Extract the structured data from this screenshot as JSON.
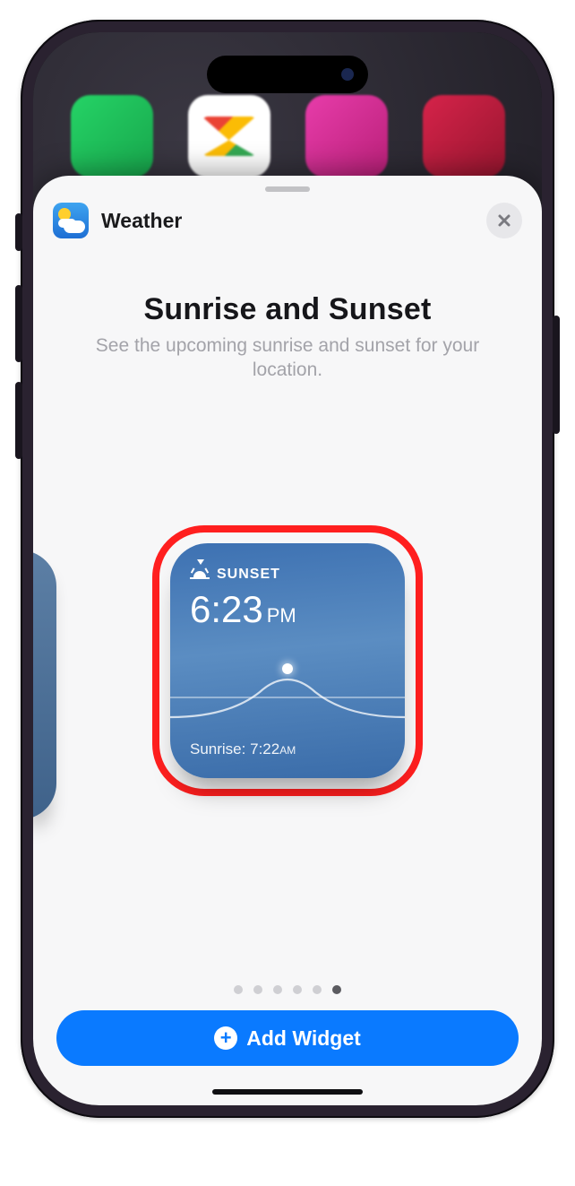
{
  "app_name": "Weather",
  "widget": {
    "title": "Sunrise and Sunset",
    "description": "See the upcoming sunrise and sunset for your location.",
    "preview": {
      "header_label": "SUNSET",
      "time": "6:23",
      "ampm": "PM",
      "sunrise_label": "Sunrise:",
      "sunrise_time": "7:22",
      "sunrise_ampm": "AM"
    }
  },
  "pager": {
    "count": 6,
    "active_index": 5
  },
  "add_button_label": "Add Widget",
  "icons": {
    "close": "close-icon",
    "weather_app": "weather-app-icon",
    "sunset": "sunset-icon",
    "plus": "plus-circle-icon"
  }
}
